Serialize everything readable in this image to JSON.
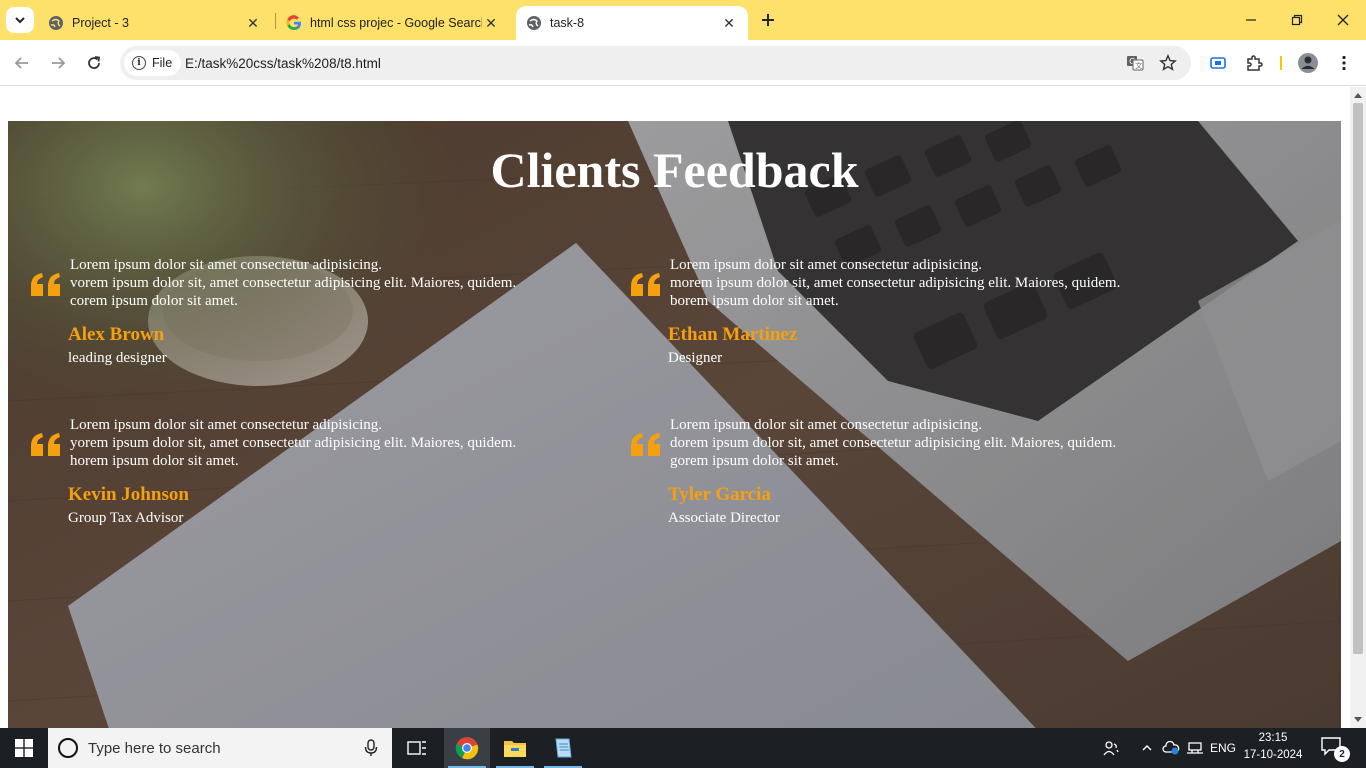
{
  "browser": {
    "tabs": [
      {
        "title": "Project - 3",
        "active": false
      },
      {
        "title": "html css projec - Google Search",
        "active": false
      },
      {
        "title": "task-8",
        "active": true
      }
    ],
    "address": {
      "scheme_chip": "File",
      "url": "E:/task%20css/task%208/t8.html"
    },
    "accent": "#fde16a"
  },
  "page": {
    "heading": "Clients Feedback",
    "name_color": "#f5a00f",
    "testimonials": [
      {
        "lines": [
          "Lorem ipsum dolor sit amet consectetur adipisicing.",
          "vorem ipsum dolor sit, amet consectetur adipisicing elit. Maiores, quidem.",
          "corem ipsum dolor sit amet."
        ],
        "name": "Alex Brown",
        "role": "leading designer"
      },
      {
        "lines": [
          "Lorem ipsum dolor sit amet consectetur adipisicing.",
          "morem ipsum dolor sit, amet consectetur adipisicing elit. Maiores, quidem.",
          "borem ipsum dolor sit amet."
        ],
        "name": "Ethan Martinez",
        "role": "Designer"
      },
      {
        "lines": [
          "Lorem ipsum dolor sit amet consectetur adipisicing.",
          "yorem ipsum dolor sit, amet consectetur adipisicing elit. Maiores, quidem.",
          "horem ipsum dolor sit amet."
        ],
        "name": "Kevin Johnson",
        "role": "Group Tax Advisor"
      },
      {
        "lines": [
          "Lorem ipsum dolor sit amet consectetur adipisicing.",
          "dorem ipsum dolor sit, amet consectetur adipisicing elit. Maiores, quidem.",
          "gorem ipsum dolor sit amet."
        ],
        "name": "Tyler Garcia",
        "role": "Associate Director"
      }
    ]
  },
  "taskbar": {
    "search_placeholder": "Type here to search",
    "apps": [
      "chrome-icon",
      "file-explorer-icon",
      "notepad-icon"
    ],
    "language": "ENG",
    "time": "23:15",
    "date": "17-10-2024",
    "notification_count": "2"
  }
}
